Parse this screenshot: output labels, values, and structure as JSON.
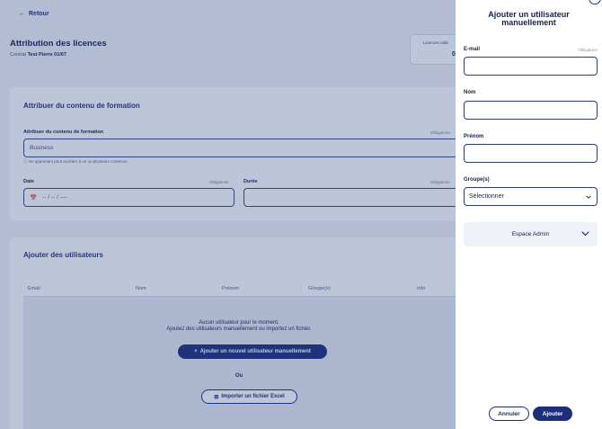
{
  "page": {
    "back_label": "Retour",
    "title": "Attribution des licences",
    "contract_prefix": "Contrat",
    "contract_name": "Test Pierre 01/07",
    "licences_label": "Licences utilis",
    "licences_value": "0"
  },
  "content_section": {
    "title": "Attribuer du contenu de formation",
    "content_label": "Attribuer du contenu de formation",
    "required": "Obligatoire",
    "content_value": "Business",
    "hint": "Un apprenant peut accéder à un ou plusieurs contenus.",
    "date_label": "Date",
    "date_placeholder": "-- / -- / ----",
    "duration_label": "Durée"
  },
  "users_section": {
    "title": "Ajouter des utilisateurs",
    "columns": [
      "Email",
      "Nom",
      "Prénom",
      "Groupe(s)",
      "Info"
    ],
    "empty_line1": "Aucun utilisateur pour le moment.",
    "empty_line2": "Ajoutez des utilisateurs manuellement ou importez un fichier.",
    "add_manual_label": "Ajouter un nouvel utilisateur manuellement",
    "or_label": "Ou",
    "import_label": "Importer un fichier Excel"
  },
  "panel": {
    "title": "Ajouter un utilisateur manuellement",
    "email_label": "E-mail",
    "required": "Obligatoire",
    "email_value": "",
    "nom_label": "Nom",
    "nom_value": "",
    "prenom_label": "Prénom",
    "prenom_value": "",
    "groups_label": "Groupe(s)",
    "groups_value": "Sélectionner",
    "admin_section_label": "Espace Admin",
    "cancel_label": "Annuler",
    "add_label": "Ajouter"
  },
  "colors": {
    "primary": "#1e2f7a",
    "overlay": "#263e82"
  }
}
